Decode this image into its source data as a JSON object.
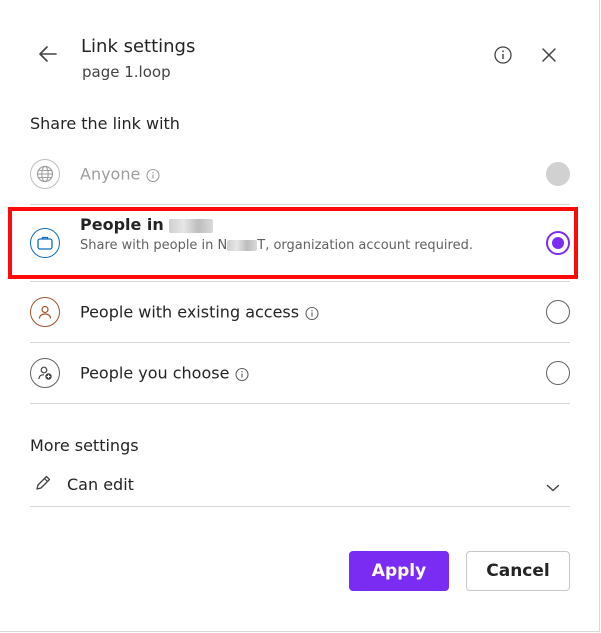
{
  "header": {
    "title": "Link settings",
    "subtitle": "page 1.loop"
  },
  "share_section": {
    "title": "Share the link with",
    "options": [
      {
        "label": "Anyone",
        "state": "disabled",
        "icon": "globe-icon",
        "has_info": true
      },
      {
        "label": "People in",
        "description_prefix": "Share with people in N",
        "description_suffix": "T, organization account required.",
        "state": "selected",
        "icon": "briefcase-icon"
      },
      {
        "label": "People with existing access",
        "state": "unselected",
        "icon": "person-icon",
        "has_info": true
      },
      {
        "label": "People you choose",
        "state": "unselected",
        "icon": "person-add-icon",
        "has_info": true
      }
    ]
  },
  "more_settings": {
    "title": "More settings",
    "permission": "Can edit"
  },
  "buttons": {
    "apply": "Apply",
    "cancel": "Cancel"
  },
  "colors": {
    "accent": "#7b2cf2",
    "highlight": "#ff0a0a"
  }
}
